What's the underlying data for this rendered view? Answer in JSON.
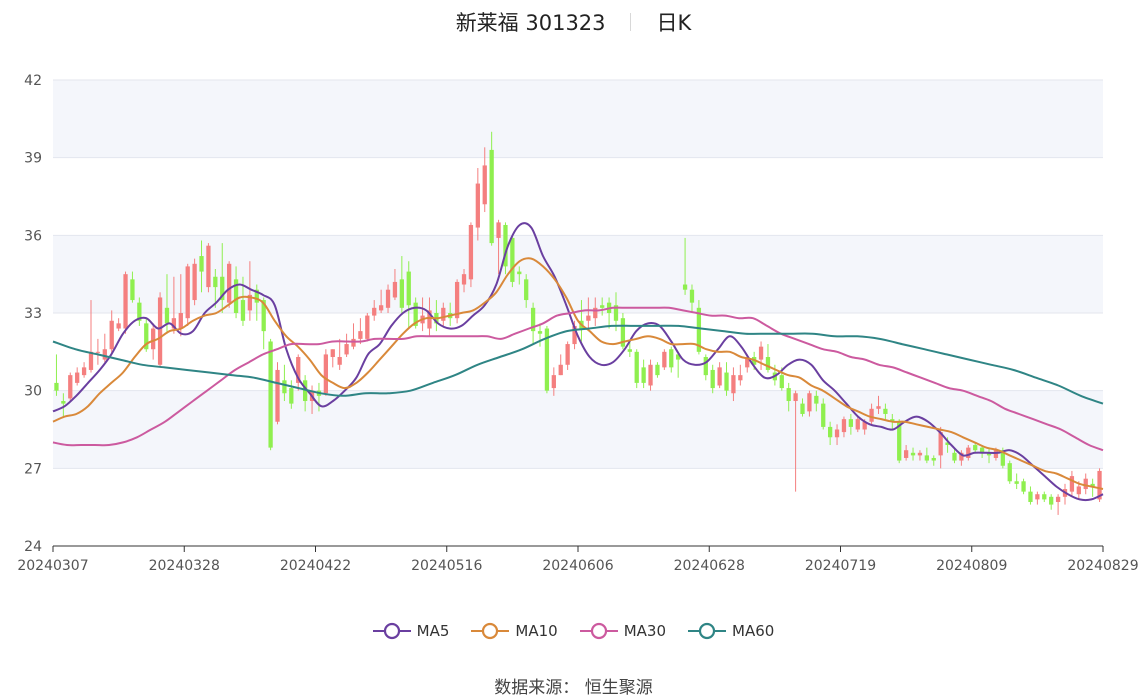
{
  "header": {
    "title": "新莱福 301323",
    "period": "日K"
  },
  "legend": [
    {
      "name": "MA5",
      "color": "#6a3fa0"
    },
    {
      "name": "MA10",
      "color": "#d9893a"
    },
    {
      "name": "MA30",
      "color": "#cc5a9f"
    },
    {
      "name": "MA60",
      "color": "#2f8585"
    }
  ],
  "source": "数据来源： 恒生聚源",
  "chart_data": {
    "type": "candlestick",
    "ylim": [
      24,
      42
    ],
    "yticks": [
      24,
      27,
      30,
      33,
      36,
      39,
      42
    ],
    "xticks": [
      "20240307",
      "20240328",
      "20240422",
      "20240516",
      "20240606",
      "20240628",
      "20240719",
      "20240809",
      "20240829"
    ],
    "up_color": "#f47f7f",
    "down_color": "#8fef4f",
    "candles": [
      [
        30.3,
        30.0,
        31.4,
        29.8
      ],
      [
        29.6,
        29.5,
        29.9,
        29.0
      ],
      [
        29.7,
        30.6,
        30.7,
        29.6
      ],
      [
        30.3,
        30.7,
        30.9,
        30.2
      ],
      [
        30.6,
        30.9,
        31.1,
        30.5
      ],
      [
        30.8,
        31.5,
        33.5,
        30.7
      ],
      [
        31.5,
        31.5,
        32.0,
        31.0
      ],
      [
        31.2,
        31.6,
        32.2,
        31.1
      ],
      [
        31.6,
        32.7,
        33.1,
        31.4
      ],
      [
        32.4,
        32.6,
        32.8,
        32.3
      ],
      [
        32.4,
        34.5,
        34.6,
        32.2
      ],
      [
        34.3,
        33.5,
        34.6,
        33.4
      ],
      [
        33.4,
        32.7,
        33.6,
        32.5
      ],
      [
        32.6,
        31.6,
        32.8,
        31.5
      ],
      [
        31.6,
        32.4,
        32.6,
        31.2
      ],
      [
        31.0,
        33.6,
        33.8,
        30.9
      ],
      [
        33.2,
        32.6,
        34.5,
        32.2
      ],
      [
        32.4,
        32.8,
        34.4,
        32.2
      ],
      [
        32.4,
        33.0,
        34.5,
        32.1
      ],
      [
        32.8,
        34.8,
        34.9,
        32.5
      ],
      [
        33.5,
        34.9,
        35.1,
        33.3
      ],
      [
        35.2,
        34.6,
        35.8,
        33.8
      ],
      [
        34.0,
        35.6,
        35.7,
        33.8
      ],
      [
        34.4,
        34.0,
        34.7,
        33.2
      ],
      [
        34.4,
        33.5,
        35.7,
        33.0
      ],
      [
        33.4,
        34.9,
        35.0,
        33.2
      ],
      [
        34.3,
        33.0,
        34.8,
        32.8
      ],
      [
        33.5,
        32.7,
        34.4,
        32.5
      ],
      [
        33.1,
        33.7,
        35.0,
        32.7
      ],
      [
        33.9,
        33.4,
        34.1,
        32.7
      ],
      [
        33.5,
        32.3,
        33.6,
        31.6
      ],
      [
        31.9,
        27.8,
        32.0,
        27.7
      ],
      [
        28.8,
        30.8,
        31.1,
        28.7
      ],
      [
        30.4,
        29.9,
        31.0,
        29.6
      ],
      [
        30.1,
        29.5,
        30.4,
        29.3
      ],
      [
        30.3,
        31.3,
        31.4,
        30.0
      ],
      [
        30.4,
        29.6,
        30.6,
        29.2
      ],
      [
        29.6,
        30.0,
        30.2,
        29.1
      ],
      [
        30.0,
        29.8,
        30.3,
        29.2
      ],
      [
        29.9,
        31.4,
        31.6,
        29.8
      ],
      [
        31.3,
        31.6,
        31.6,
        30.9
      ],
      [
        31.0,
        31.3,
        32.0,
        30.8
      ],
      [
        31.4,
        31.8,
        32.2,
        31.3
      ],
      [
        31.7,
        32.0,
        32.6,
        31.6
      ],
      [
        32.0,
        32.3,
        32.8,
        31.8
      ],
      [
        32.0,
        32.9,
        33.0,
        31.9
      ],
      [
        32.9,
        33.2,
        33.5,
        32.7
      ],
      [
        33.1,
        33.3,
        33.9,
        33.0
      ],
      [
        33.2,
        33.9,
        34.1,
        33.0
      ],
      [
        33.6,
        34.2,
        34.7,
        33.5
      ],
      [
        34.3,
        33.2,
        35.2,
        33.0
      ],
      [
        34.6,
        33.3,
        35.0,
        32.4
      ],
      [
        33.4,
        32.5,
        33.6,
        32.4
      ],
      [
        32.6,
        32.9,
        33.6,
        32.3
      ],
      [
        32.4,
        33.1,
        33.6,
        32.1
      ],
      [
        33.0,
        32.6,
        33.5,
        32.3
      ],
      [
        32.7,
        33.2,
        33.4,
        32.5
      ],
      [
        33.0,
        32.8,
        33.4,
        32.5
      ],
      [
        32.8,
        34.2,
        34.3,
        32.6
      ],
      [
        34.1,
        34.5,
        34.7,
        33.8
      ],
      [
        34.3,
        36.4,
        36.5,
        34.0
      ],
      [
        36.3,
        38.0,
        38.6,
        35.8
      ],
      [
        37.2,
        38.7,
        39.4,
        36.9
      ],
      [
        39.3,
        35.7,
        40.0,
        35.6
      ],
      [
        35.9,
        36.5,
        36.6,
        34.5
      ],
      [
        36.4,
        34.8,
        36.5,
        34.5
      ],
      [
        35.9,
        34.2,
        36.0,
        34.0
      ],
      [
        34.6,
        34.5,
        34.8,
        34.1
      ],
      [
        34.3,
        33.5,
        34.5,
        33.2
      ],
      [
        33.2,
        32.3,
        33.4,
        31.8
      ],
      [
        32.3,
        32.2,
        32.6,
        31.7
      ],
      [
        32.4,
        30.0,
        32.5,
        29.9
      ],
      [
        30.1,
        30.6,
        30.9,
        29.8
      ],
      [
        30.6,
        31.0,
        31.4,
        30.6
      ],
      [
        31.0,
        31.8,
        31.9,
        30.8
      ],
      [
        31.8,
        32.5,
        32.7,
        31.6
      ],
      [
        32.7,
        32.4,
        33.5,
        31.9
      ],
      [
        32.7,
        32.9,
        33.6,
        32.4
      ],
      [
        32.8,
        33.2,
        33.6,
        32.5
      ],
      [
        33.3,
        33.2,
        33.6,
        32.9
      ],
      [
        33.4,
        33.0,
        33.6,
        32.4
      ],
      [
        33.3,
        32.7,
        33.8,
        32.3
      ],
      [
        32.8,
        31.7,
        33.0,
        31.6
      ],
      [
        31.6,
        31.5,
        31.9,
        31.3
      ],
      [
        31.5,
        30.3,
        31.6,
        30.1
      ],
      [
        30.9,
        30.3,
        31.2,
        30.1
      ],
      [
        30.2,
        31.0,
        31.2,
        30.0
      ],
      [
        31.0,
        30.6,
        31.1,
        30.5
      ],
      [
        30.9,
        31.5,
        31.6,
        30.8
      ],
      [
        31.6,
        30.9,
        31.7,
        30.7
      ],
      [
        31.4,
        31.2,
        31.5,
        30.5
      ],
      [
        34.1,
        33.9,
        35.9,
        33.7
      ],
      [
        33.9,
        33.4,
        34.1,
        33.0
      ],
      [
        33.2,
        31.5,
        33.5,
        31.4
      ],
      [
        31.3,
        30.6,
        31.4,
        30.4
      ],
      [
        30.8,
        30.1,
        31.0,
        29.9
      ],
      [
        30.2,
        30.9,
        31.1,
        30.1
      ],
      [
        30.7,
        30.0,
        31.1,
        29.8
      ],
      [
        29.9,
        30.6,
        30.9,
        29.6
      ],
      [
        30.4,
        30.6,
        31.0,
        30.2
      ],
      [
        30.9,
        31.3,
        31.4,
        30.7
      ],
      [
        31.3,
        31.0,
        31.5,
        30.8
      ],
      [
        31.2,
        31.7,
        31.9,
        30.8
      ],
      [
        31.3,
        30.8,
        31.8,
        30.7
      ],
      [
        30.7,
        30.4,
        31.0,
        30.2
      ],
      [
        30.6,
        30.1,
        30.9,
        30.0
      ],
      [
        30.1,
        29.6,
        30.3,
        29.2
      ],
      [
        29.6,
        29.9,
        30.0,
        26.1
      ],
      [
        29.5,
        29.1,
        29.7,
        29.0
      ],
      [
        29.2,
        29.9,
        30.0,
        29.0
      ],
      [
        29.8,
        29.5,
        30.0,
        29.2
      ],
      [
        29.5,
        28.6,
        29.7,
        28.5
      ],
      [
        28.6,
        28.2,
        28.8,
        27.9
      ],
      [
        28.2,
        28.5,
        28.7,
        27.9
      ],
      [
        28.4,
        28.9,
        29.0,
        28.2
      ],
      [
        28.9,
        28.6,
        29.1,
        28.3
      ],
      [
        28.5,
        28.9,
        29.0,
        28.4
      ],
      [
        28.5,
        28.8,
        28.9,
        28.3
      ],
      [
        28.8,
        29.3,
        29.5,
        28.7
      ],
      [
        29.3,
        29.4,
        29.8,
        29.1
      ],
      [
        29.3,
        29.1,
        29.5,
        28.9
      ],
      [
        28.9,
        28.8,
        29.1,
        28.5
      ],
      [
        28.8,
        27.3,
        28.9,
        27.2
      ],
      [
        27.4,
        27.7,
        27.9,
        27.3
      ],
      [
        27.6,
        27.5,
        27.8,
        27.3
      ],
      [
        27.5,
        27.6,
        27.7,
        27.3
      ],
      [
        27.5,
        27.3,
        27.8,
        27.2
      ],
      [
        27.4,
        27.3,
        27.5,
        27.1
      ],
      [
        27.5,
        28.4,
        28.6,
        27.0
      ],
      [
        28.0,
        27.9,
        28.2,
        27.6
      ],
      [
        27.6,
        27.3,
        27.8,
        27.2
      ],
      [
        27.3,
        27.6,
        27.7,
        27.1
      ],
      [
        27.4,
        27.8,
        27.9,
        27.3
      ],
      [
        27.9,
        27.7,
        28.0,
        27.6
      ],
      [
        27.8,
        27.6,
        27.9,
        27.4
      ],
      [
        27.6,
        27.5,
        27.8,
        27.2
      ],
      [
        27.4,
        27.7,
        27.8,
        27.3
      ],
      [
        27.7,
        27.1,
        27.8,
        27.0
      ],
      [
        27.2,
        26.5,
        27.3,
        26.4
      ],
      [
        26.5,
        26.4,
        26.8,
        26.2
      ],
      [
        26.5,
        26.1,
        26.6,
        26.0
      ],
      [
        26.1,
        25.7,
        26.3,
        25.6
      ],
      [
        25.8,
        26.0,
        26.1,
        25.6
      ],
      [
        26.0,
        25.8,
        26.1,
        25.7
      ],
      [
        25.9,
        25.6,
        26.0,
        25.4
      ],
      [
        25.7,
        25.9,
        26.0,
        25.2
      ],
      [
        25.9,
        26.2,
        26.4,
        25.6
      ],
      [
        26.1,
        26.7,
        26.9,
        25.9
      ],
      [
        26.0,
        26.3,
        26.5,
        25.8
      ],
      [
        26.2,
        26.6,
        26.8,
        26.0
      ],
      [
        26.4,
        26.3,
        26.6,
        25.9
      ],
      [
        25.8,
        26.9,
        27.0,
        25.7
      ]
    ],
    "ma": {
      "MA5": [
        29.2,
        29.4,
        29.8,
        30.3,
        30.8,
        31.4,
        32.2,
        32.7,
        32.8,
        32.4,
        32.6,
        32.2,
        32.3,
        33.0,
        33.4,
        33.9,
        34.1,
        33.9,
        33.7,
        33.3,
        31.6,
        30.5,
        29.9,
        29.4,
        29.6,
        30.0,
        30.5,
        31.4,
        31.8,
        32.5,
        33.0,
        33.2,
        33.1,
        32.6,
        32.4,
        32.5,
        32.9,
        33.3,
        34.1,
        35.6,
        36.4,
        36.3,
        35.2,
        34.4,
        33.3,
        32.1,
        31.3,
        31.0,
        31.1,
        31.6,
        32.3,
        32.6,
        32.5,
        31.9,
        31.2,
        31.0,
        31.1,
        31.6,
        32.1,
        31.7,
        31.0,
        30.5,
        30.6,
        31.0,
        31.2,
        31.0,
        30.4,
        30.0,
        29.5,
        29.0,
        28.7,
        28.6,
        28.5,
        28.8,
        29.0,
        28.8,
        28.4,
        27.9,
        27.5,
        27.6,
        27.6,
        27.6,
        27.7,
        27.5,
        27.1,
        26.7,
        26.3,
        26.0,
        25.8,
        25.8,
        26.0
      ],
      "MA10": [
        28.8,
        29.0,
        29.1,
        29.4,
        29.9,
        30.3,
        30.7,
        31.3,
        31.8,
        32.0,
        32.3,
        32.4,
        32.7,
        32.9,
        33.0,
        33.3,
        33.6,
        33.6,
        33.4,
        32.7,
        32.1,
        31.7,
        31.2,
        30.6,
        30.3,
        30.1,
        30.3,
        30.7,
        31.2,
        31.7,
        32.2,
        32.6,
        32.8,
        32.8,
        32.9,
        33.0,
        33.1,
        33.4,
        33.8,
        34.5,
        35.0,
        35.1,
        34.8,
        34.3,
        33.6,
        32.7,
        32.3,
        31.9,
        31.8,
        31.9,
        32.0,
        32.1,
        32.0,
        31.8,
        31.8,
        31.8,
        31.6,
        31.5,
        31.5,
        31.3,
        31.2,
        31.0,
        30.8,
        30.6,
        30.5,
        30.2,
        30.0,
        29.7,
        29.4,
        29.2,
        29.0,
        28.9,
        28.8,
        28.8,
        28.7,
        28.6,
        28.5,
        28.4,
        28.2,
        28.0,
        27.8,
        27.7,
        27.5,
        27.3,
        27.1,
        26.9,
        26.8,
        26.6,
        26.4,
        26.3,
        26.2
      ],
      "MA30": [
        28.0,
        27.9,
        27.9,
        27.9,
        27.9,
        28.0,
        28.2,
        28.5,
        28.8,
        29.2,
        29.6,
        30.0,
        30.4,
        30.8,
        31.1,
        31.4,
        31.6,
        31.8,
        31.8,
        31.8,
        31.9,
        31.9,
        31.9,
        32.0,
        32.0,
        32.0,
        32.1,
        32.1,
        32.1,
        32.1,
        32.1,
        32.1,
        32.0,
        32.2,
        32.4,
        32.6,
        32.9,
        33.0,
        33.1,
        33.1,
        33.2,
        33.2,
        33.2,
        33.2,
        33.2,
        33.1,
        33.0,
        32.9,
        32.9,
        32.8,
        32.8,
        32.5,
        32.2,
        32.0,
        31.8,
        31.6,
        31.5,
        31.3,
        31.2,
        31.0,
        30.9,
        30.7,
        30.5,
        30.3,
        30.1,
        30.0,
        29.8,
        29.6,
        29.3,
        29.1,
        28.9,
        28.7,
        28.5,
        28.2,
        27.9,
        27.7
      ],
      "MA60": [
        31.9,
        31.6,
        31.4,
        31.2,
        31.0,
        30.9,
        30.8,
        30.7,
        30.6,
        30.5,
        30.3,
        30.1,
        29.9,
        29.8,
        29.9,
        29.9,
        30.0,
        30.3,
        30.6,
        31.0,
        31.3,
        31.6,
        32.0,
        32.3,
        32.4,
        32.5,
        32.5,
        32.5,
        32.5,
        32.4,
        32.3,
        32.2,
        32.2,
        32.2,
        32.2,
        32.1,
        32.1,
        32.0,
        31.8,
        31.6,
        31.4,
        31.2,
        31.0,
        30.8,
        30.5,
        30.2,
        29.8,
        29.5
      ]
    }
  }
}
